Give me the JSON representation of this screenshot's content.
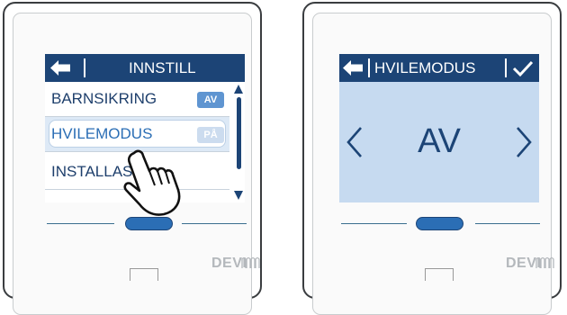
{
  "left_panel": {
    "header_title": "INNSTILL",
    "menu_items": [
      {
        "label": "BARNSIKRING",
        "badge": "AV"
      },
      {
        "label": "HVILEMODUS",
        "badge": "PÅ"
      },
      {
        "label": "INSTALLAS"
      }
    ],
    "brand": "DEVI"
  },
  "right_panel": {
    "header_title": "HVILEMODUS",
    "value": "AV",
    "brand": "DEVI"
  },
  "colors": {
    "header_bg": "#1c4476",
    "badge_active": "#5f95d1",
    "badge_inactive": "#ccdcef",
    "selected_row": "#ffffff",
    "screen_bg": "#c6daf0",
    "accent_pill": "#2b6eb5"
  },
  "icons": {
    "back": "back-arrow-icon",
    "confirm": "checkmark-icon",
    "prev": "chevron-left-icon",
    "next": "chevron-right-icon",
    "scroll_up": "triangle-up-icon",
    "scroll_down": "triangle-down-icon",
    "pointer": "hand-pointer-icon",
    "brand_mark": "wave-logo-icon"
  }
}
